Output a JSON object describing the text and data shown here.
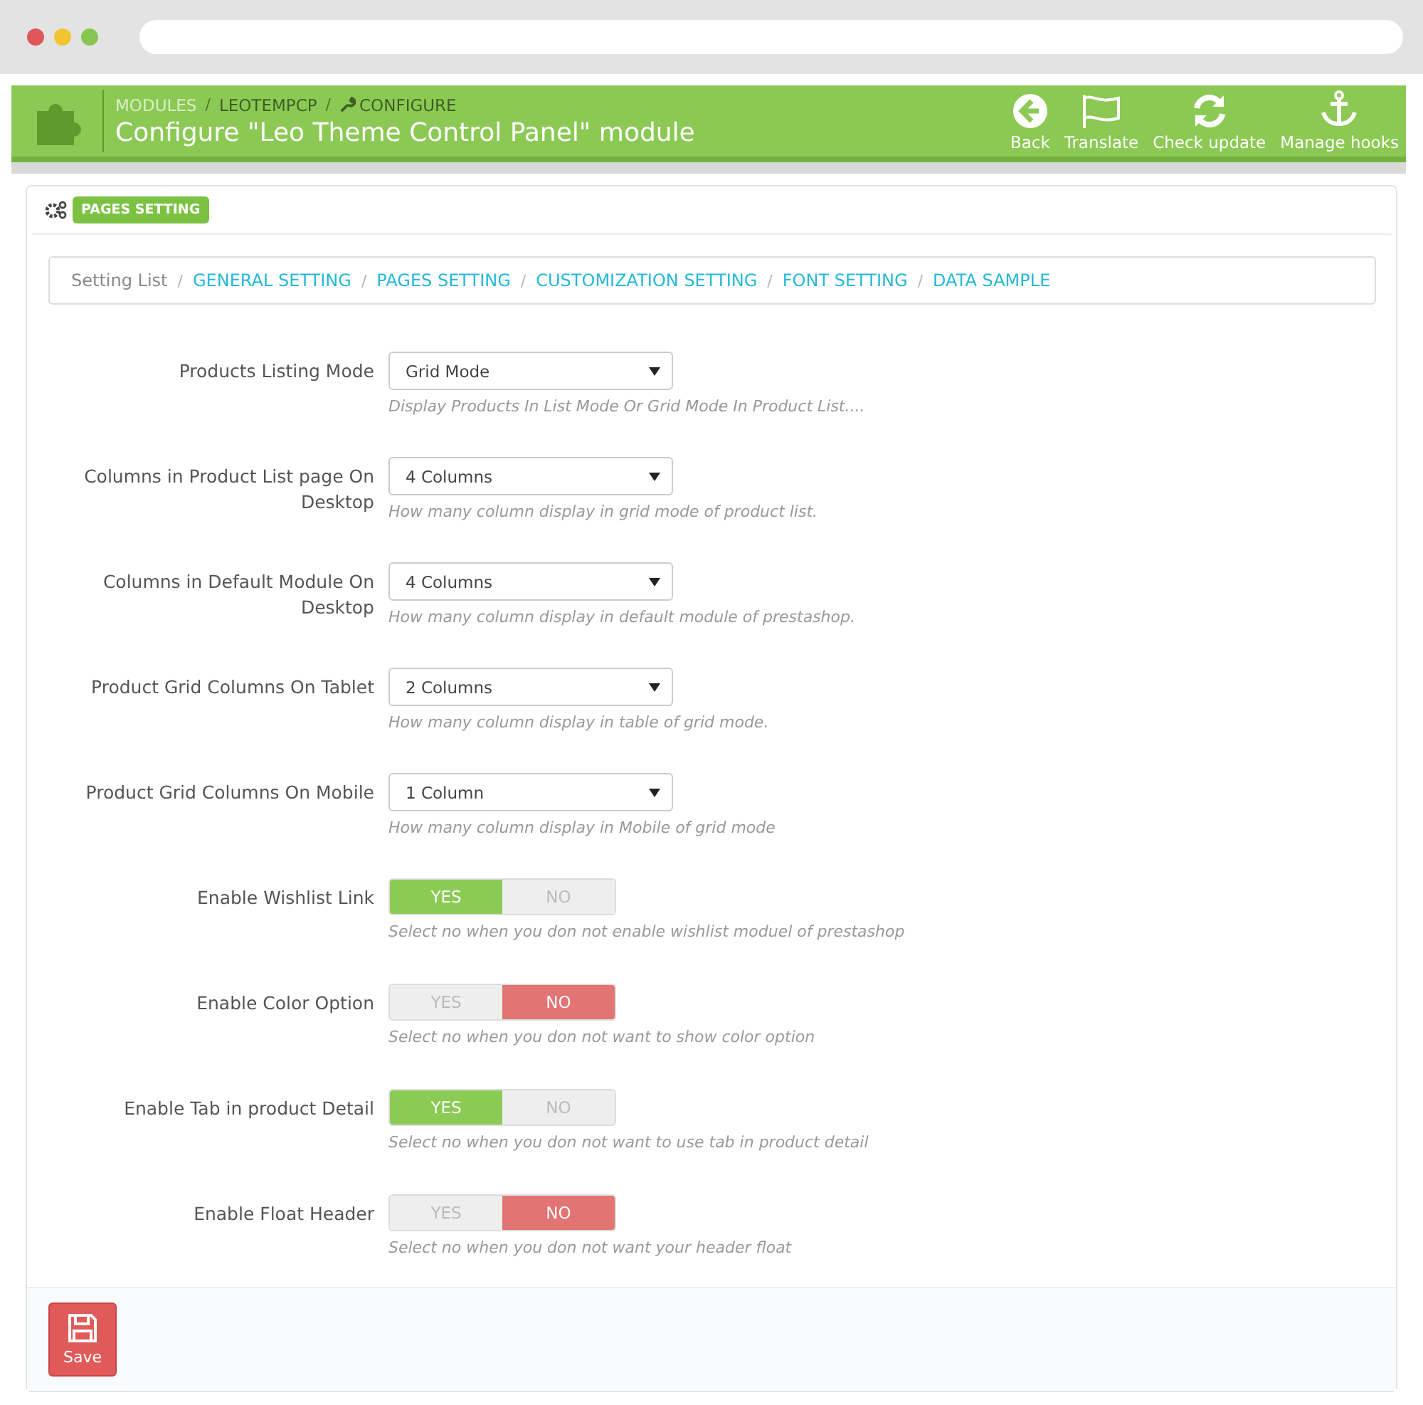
{
  "header": {
    "separator": "/",
    "breadcrumb": [
      {
        "kind": "plain",
        "label": "MODULES",
        "muted": true
      },
      {
        "kind": "plain",
        "label": "LEOTEMPCP",
        "muted": false
      },
      {
        "kind": "wrench",
        "label": "CONFIGURE",
        "muted": false
      }
    ],
    "title": "Configure \"Leo Theme Control Panel\" module",
    "actions": [
      {
        "kind": "back",
        "label": "Back"
      },
      {
        "kind": "flag",
        "label": "Translate"
      },
      {
        "kind": "refresh",
        "label": "Check update"
      },
      {
        "kind": "anchor",
        "label": "Manage hooks"
      }
    ]
  },
  "panel": {
    "heading": "PAGES SETTING",
    "setting_separator": "/",
    "setting_list": [
      {
        "label": "Setting List",
        "link": false
      },
      {
        "label": "GENERAL SETTING",
        "link": true
      },
      {
        "label": "PAGES SETTING",
        "link": true
      },
      {
        "label": "CUSTOMIZATION SETTING",
        "link": true
      },
      {
        "label": "FONT SETTING",
        "link": true
      },
      {
        "label": "DATA SAMPLE",
        "link": true
      }
    ],
    "fields": [
      {
        "kind": "select",
        "label": "Products Listing Mode",
        "value": "Grid Mode",
        "help": "Display Products In List Mode Or Grid Mode In Product List...."
      },
      {
        "kind": "select",
        "label": "Columns in Product List page On Desktop",
        "value": "4 Columns",
        "help": "How many column display in grid mode of product list."
      },
      {
        "kind": "select",
        "label": "Columns in Default Module On Desktop",
        "value": "4 Columns",
        "help": "How many column display in default module of prestashop."
      },
      {
        "kind": "select",
        "label": "Product Grid Columns On Tablet",
        "value": "2 Columns",
        "help": "How many column display in table of grid mode."
      },
      {
        "kind": "select",
        "label": "Product Grid Columns On Mobile",
        "value": "1 Column",
        "help": "How many column display in Mobile of grid mode"
      },
      {
        "kind": "switch",
        "label": "Enable Wishlist Link",
        "yes": "YES",
        "no": "NO",
        "on": true,
        "help": "Select no when you don not enable wishlist moduel of prestashop"
      },
      {
        "kind": "switch",
        "label": "Enable Color Option",
        "yes": "YES",
        "no": "NO",
        "on": false,
        "help": "Select no when you don not want to show color option"
      },
      {
        "kind": "switch",
        "label": "Enable Tab in product Detail",
        "yes": "YES",
        "no": "NO",
        "on": true,
        "help": "Select no when you don not want to use tab in product detail"
      },
      {
        "kind": "switch",
        "label": "Enable Float Header",
        "yes": "YES",
        "no": "NO",
        "on": false,
        "help": "Select no when you don not want your header float"
      }
    ],
    "save": "Save"
  }
}
